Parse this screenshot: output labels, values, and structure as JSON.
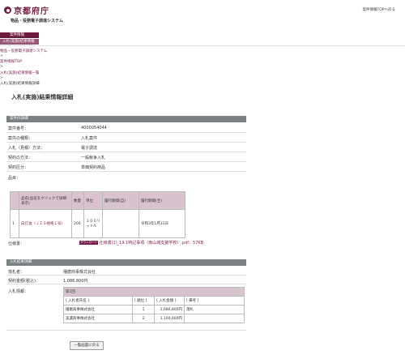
{
  "header": {
    "logo_text": "京都府庁",
    "subtitle": "物品・役務電子調達システム",
    "top_link": "案件情報TOPへ戻る"
  },
  "nav": {
    "tab1": "案件情報",
    "tab2": "入札(実施)結果情報"
  },
  "breadcrumb": {
    "items": [
      "物品・役務電子調達システム",
      "案件情報TOP",
      "入札(実施)結果情報一覧",
      "入札(実施)結果情報詳細"
    ],
    "separator": ">"
  },
  "page_title": "入札(実施)結果情報詳細",
  "case_section": {
    "header": "案件の詳細",
    "rows": [
      {
        "label": "案件番号：",
        "value": "4000054044"
      },
      {
        "label": "案件の種類：",
        "value": "入札案件"
      },
      {
        "label": "入札（見積）方法：",
        "value": "電子調達"
      },
      {
        "label": "契約の方法：",
        "value": "一般競争入札"
      },
      {
        "label": "契約区分：",
        "value": "単価契約用品"
      }
    ],
    "items_label": "品目：",
    "items_table": {
      "headers": [
        "",
        "品名(品名をクリックで詳細表示)",
        "数量",
        "単位",
        "履行期間(自)",
        "履行期間(至)"
      ],
      "rows": [
        {
          "no": "1",
          "name": "白灯油（ＪＩＳ規格１号）",
          "qty": "200",
          "unit": "１００リットル",
          "from": "",
          "to": "令和3年1月31日"
        }
      ]
    },
    "spec_label": "仕様書：",
    "spec_badge": "ダウンロード",
    "spec_file": "仕様書(1)_19.1特記事項（南山城支援学校）.pdf：57KB"
  },
  "result_section": {
    "header": "入札結果詳細",
    "rows": [
      {
        "label": "落札者：",
        "value": "播磨商事株式会社"
      },
      {
        "label": "契約金額(税込)：",
        "value": "1,086,800円"
      }
    ],
    "bid_label": "入札情報：",
    "bid_round": "第1回",
    "bid_headers": [
      "[ 入札者氏名 ]",
      "[ 順位 ]",
      "[ 入札金額 ]",
      "[ 備考 ]"
    ],
    "bids": [
      {
        "name": "播磨商事株式会社",
        "rank": "1",
        "amount": "1,086,800円",
        "note": "落札"
      },
      {
        "name": "美濃商事株式会社",
        "rank": "2",
        "amount": "1,100,000円",
        "note": ""
      }
    ]
  },
  "back_button": "一覧画面に戻る"
}
